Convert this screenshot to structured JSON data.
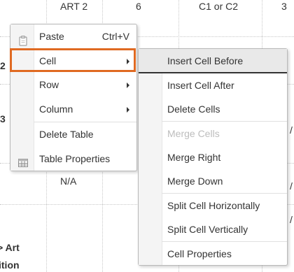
{
  "background": {
    "headers": [
      "ART 2",
      "6",
      "C1 or C2",
      "3"
    ],
    "left_cut": [
      "2",
      "3",
      "> Art",
      "ition"
    ],
    "right_cut": [
      "/",
      "/",
      "/"
    ],
    "na_label": "N/A"
  },
  "context_menu": {
    "items": [
      {
        "label": "Paste",
        "shortcut": "Ctrl+V",
        "icon": "clipboard-icon"
      },
      {
        "label": "Cell",
        "submenu": true
      },
      {
        "label": "Row",
        "submenu": true
      },
      {
        "label": "Column",
        "submenu": true
      },
      {
        "label": "Delete Table"
      },
      {
        "label": "Table Properties",
        "icon": "table-icon"
      }
    ],
    "highlight_color": "#e06a22"
  },
  "cell_submenu": {
    "items": [
      {
        "label": "Insert Cell Before",
        "active": true
      },
      {
        "label": "Insert Cell After"
      },
      {
        "label": "Delete Cells"
      },
      {
        "label": "Merge Cells",
        "disabled": true
      },
      {
        "label": "Merge Right"
      },
      {
        "label": "Merge Down"
      },
      {
        "label": "Split Cell Horizontally"
      },
      {
        "label": "Split Cell Vertically"
      },
      {
        "label": "Cell Properties"
      }
    ]
  }
}
